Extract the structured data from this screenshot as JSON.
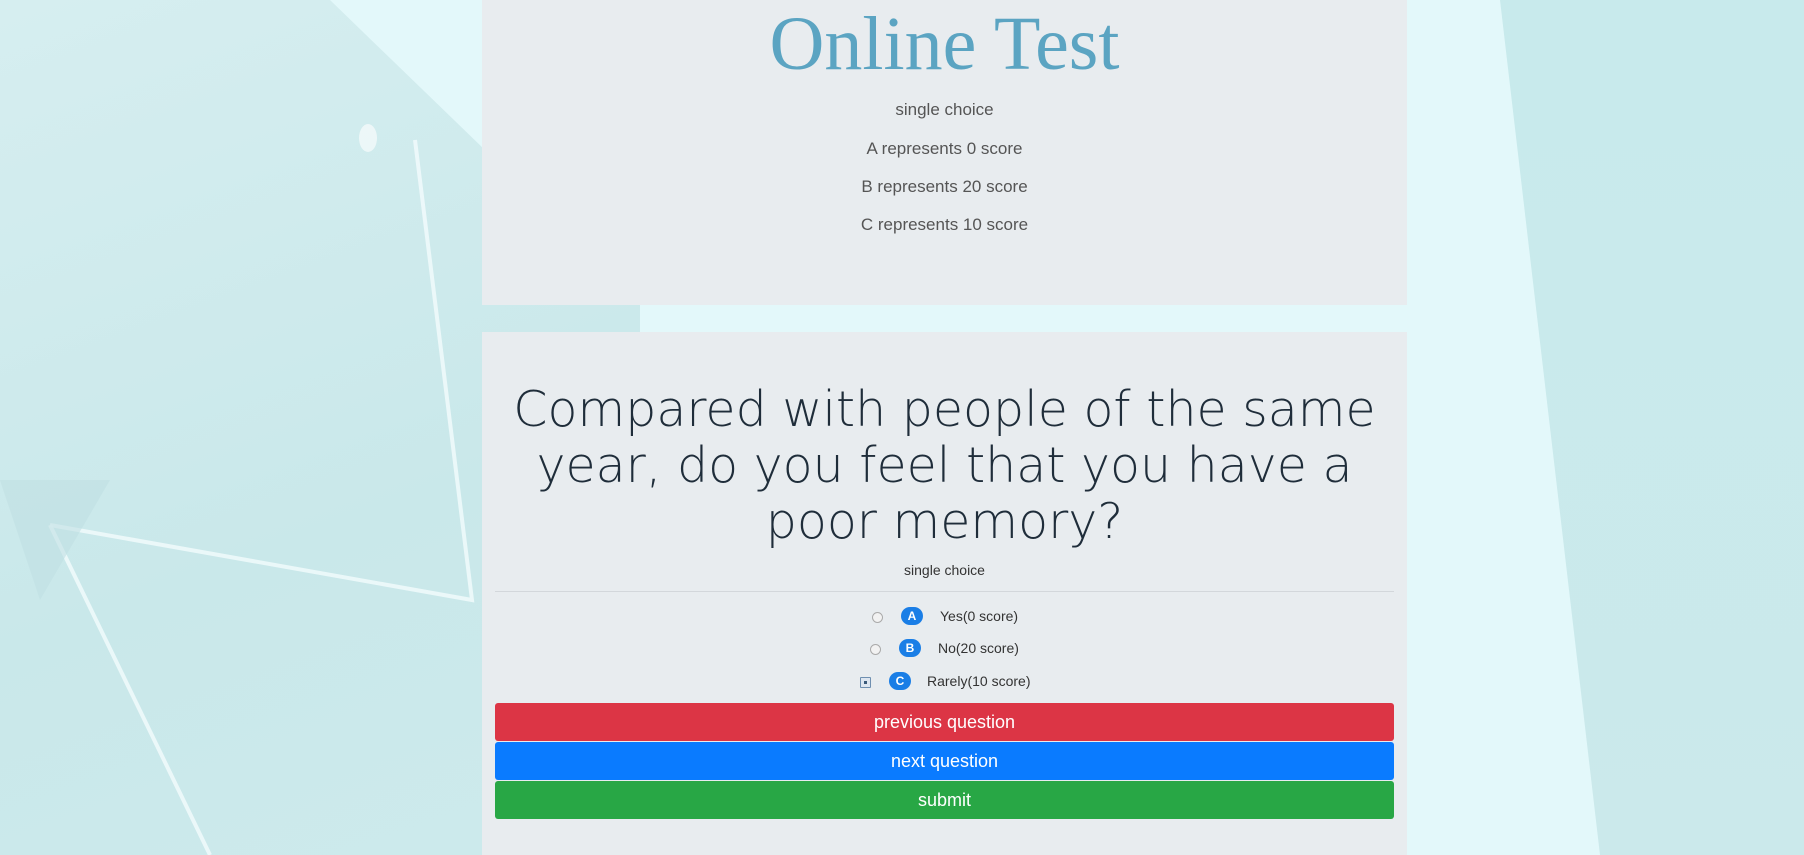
{
  "header": {
    "title": "Online Test",
    "lines": [
      "single choice",
      "A represents 0 score",
      "B represents 20 score",
      "C represents 10 score"
    ]
  },
  "question": {
    "text": "Compared with people of the same year, do you feel that you have a poor memory?",
    "type": "single choice",
    "options": [
      {
        "letter": "A",
        "label": "Yes(0 score)",
        "selected": false
      },
      {
        "letter": "B",
        "label": "No(20 score)",
        "selected": false
      },
      {
        "letter": "C",
        "label": "Rarely(10 score)",
        "selected": true
      }
    ]
  },
  "buttons": {
    "previous": "previous question",
    "next": "next question",
    "submit": "submit"
  },
  "colors": {
    "title": "#5ba4c2",
    "badge": "#1a7ee6",
    "previous": "#dc3545",
    "next": "#0a7bff",
    "submit": "#28a745"
  }
}
